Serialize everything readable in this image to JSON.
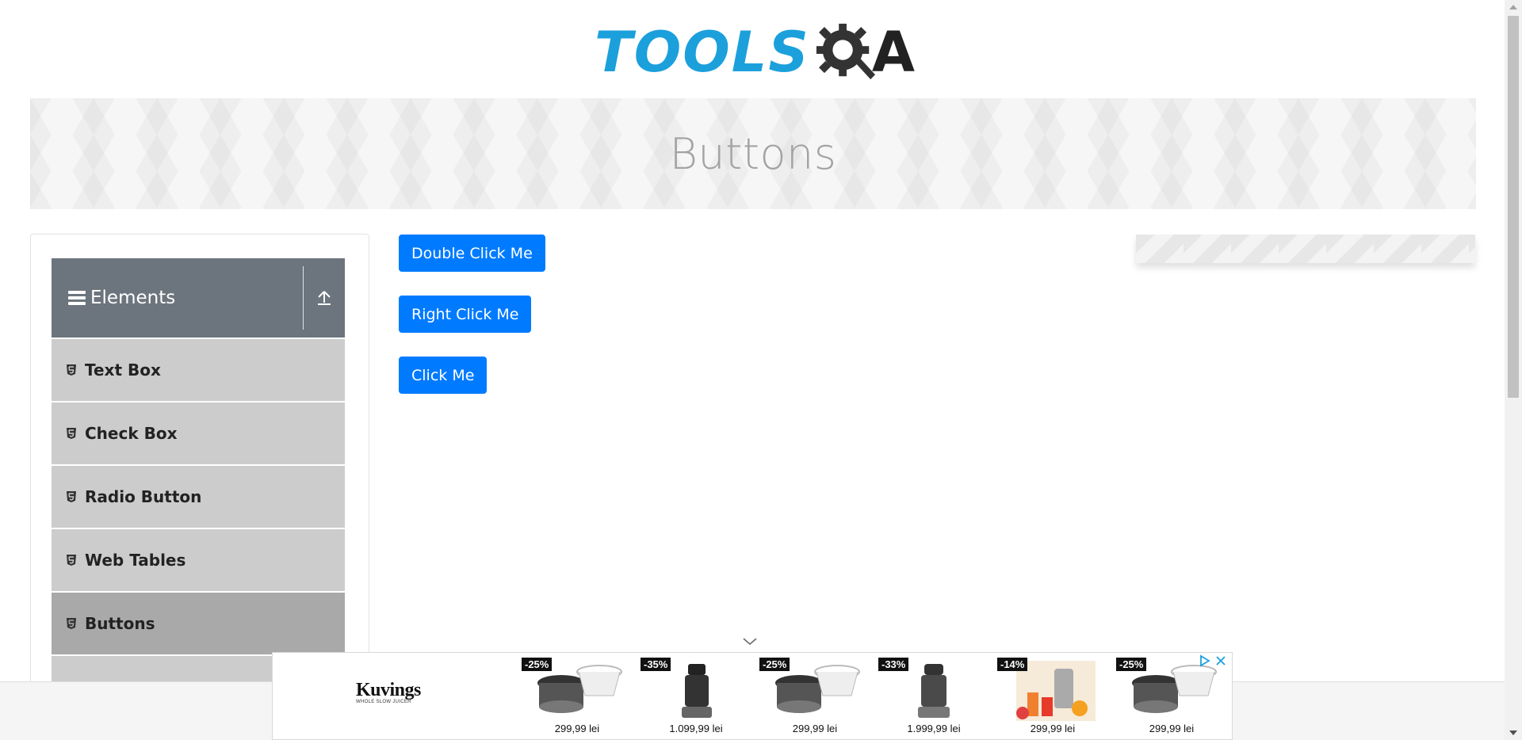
{
  "header": {
    "logo_text_left": "TOOLS",
    "logo_text_right": "A"
  },
  "banner": {
    "title": "Buttons"
  },
  "sidebar": {
    "group_title": "Elements",
    "items": [
      {
        "label": "Text Box"
      },
      {
        "label": "Check Box"
      },
      {
        "label": "Radio Button"
      },
      {
        "label": "Web Tables"
      },
      {
        "label": "Buttons",
        "active": true
      },
      {
        "label": ""
      }
    ]
  },
  "main": {
    "double_click_label": "Double Click Me",
    "right_click_label": "Right Click Me",
    "click_label": "Click Me"
  },
  "ad": {
    "brand": "Kuvings",
    "brand_tagline": "WHOLE SLOW JUICER",
    "products": [
      {
        "discount": "-25%",
        "price": "299,99 lei"
      },
      {
        "discount": "-35%",
        "price": "1.099,99 lei"
      },
      {
        "discount": "-25%",
        "price": "299,99 lei"
      },
      {
        "discount": "-33%",
        "price": "1.999,99 lei"
      },
      {
        "discount": "-14%",
        "price": "299,99 lei"
      },
      {
        "discount": "-25%",
        "price": "299,99 lei"
      }
    ]
  },
  "colors": {
    "accent": "#007bff",
    "logo_blue": "#1ba0dc",
    "sidebar_header": "#6c757d",
    "menu_item": "#cccccc",
    "menu_active": "#a9a9a9"
  }
}
